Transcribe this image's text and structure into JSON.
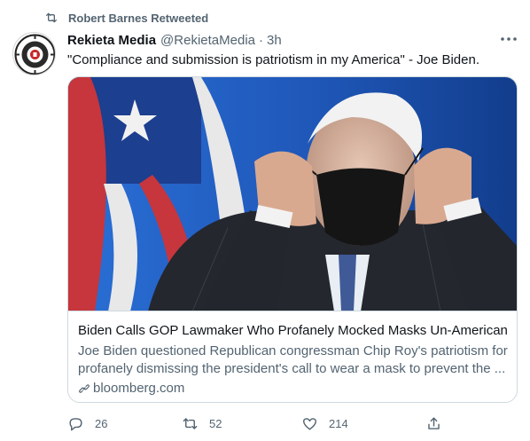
{
  "retweet_banner": {
    "text": "Robert Barnes Retweeted",
    "icon": "retweet-icon"
  },
  "tweet": {
    "author_name": "Rekieta Media",
    "handle": "@RekietaMedia",
    "separator": "·",
    "timestamp": "3h",
    "text": "\"Compliance and submission is patriotism in my America\" - Joe Biden."
  },
  "card": {
    "image_alt": "Photo of Joe Biden putting on a black face mask in front of an American flag",
    "title": "Biden Calls GOP Lawmaker Who Profanely Mocked Masks Un-American",
    "description_line1": "Joe Biden questioned Republican congressman Chip Roy's patriotism for",
    "description_line2": "profanely dismissing the president's call to wear a mask to prevent the ...",
    "domain": "bloomberg.com"
  },
  "actions": {
    "replies": "26",
    "retweets": "52",
    "likes": "214"
  },
  "colors": {
    "text_primary": "#0f1419",
    "text_secondary": "#536471",
    "border": "#cfd9de"
  }
}
